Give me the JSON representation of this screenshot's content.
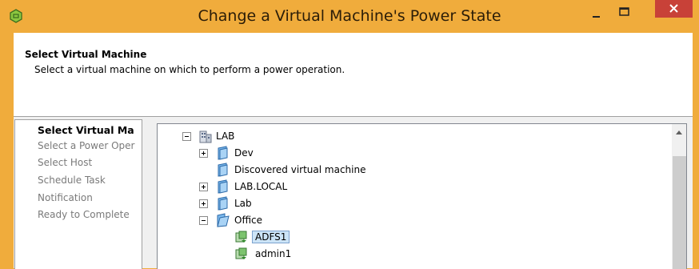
{
  "window": {
    "title": "Change a Virtual Machine's Power State",
    "accent": "#f0ac3c",
    "close_color": "#c84138"
  },
  "header": {
    "title": "Select Virtual Machine",
    "subtitle": "Select a virtual machine on which to perform a power operation."
  },
  "nav": {
    "items": [
      {
        "label": "Select Virtual Ma",
        "active": true
      },
      {
        "label": "Select a Power Oper",
        "active": false
      },
      {
        "label": "Select Host",
        "active": false
      },
      {
        "label": "Schedule Task",
        "active": false
      },
      {
        "label": "Notification",
        "active": false
      },
      {
        "label": "Ready to Complete",
        "active": false
      }
    ]
  },
  "tree": {
    "root": {
      "label": "LAB",
      "icon": "datacenter-icon",
      "expanded": true
    },
    "folders": [
      {
        "label": "Dev",
        "icon": "folder-icon",
        "expander": "plus"
      },
      {
        "label": "Discovered virtual machine",
        "icon": "folder-icon",
        "expander": "none"
      },
      {
        "label": "LAB.LOCAL",
        "icon": "folder-icon",
        "expander": "plus"
      },
      {
        "label": "Lab",
        "icon": "folder-icon",
        "expander": "plus"
      },
      {
        "label": "Office",
        "icon": "folder-open-icon",
        "expander": "minus"
      }
    ],
    "vms": [
      {
        "label": "ADFS1",
        "icon": "vm-icon",
        "selected": true
      },
      {
        "label": "admin1",
        "icon": "vm-icon",
        "selected": false
      }
    ]
  }
}
